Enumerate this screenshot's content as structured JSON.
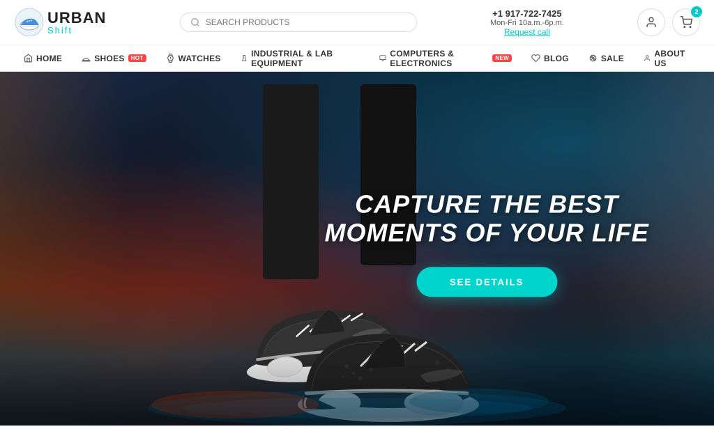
{
  "logo": {
    "urban": "URBAN",
    "shift": "Shift"
  },
  "search": {
    "placeholder": "SEARCH PRODUCTS"
  },
  "contact": {
    "phone": "+1 917-722-7425",
    "hours": "Mon-Fri 10a.m.-6p.m.",
    "request": "Request call"
  },
  "cart": {
    "badge": "2"
  },
  "nav": {
    "items": [
      {
        "label": "HOME",
        "icon": "home-icon",
        "badge": null
      },
      {
        "label": "SHOES",
        "icon": "shoe-icon",
        "badge": "HOT",
        "badge_type": "hot"
      },
      {
        "label": "WATCHES",
        "icon": "watch-icon",
        "badge": null
      },
      {
        "label": "INDUSTRIAL & LAB EQUIPMENT",
        "icon": "lab-icon",
        "badge": null
      },
      {
        "label": "COMPUTERS & ELECTRONICS",
        "icon": "computer-icon",
        "badge": "NEW",
        "badge_type": "new"
      },
      {
        "label": "BLOG",
        "icon": "blog-icon",
        "badge": null
      },
      {
        "label": "SALE",
        "icon": "sale-icon",
        "badge": null
      },
      {
        "label": "ABOUT US",
        "icon": "user-icon",
        "badge": null
      }
    ]
  },
  "hero": {
    "title_line1": "CAPTURE THE BEST",
    "title_line2": "MOMENTS OF YOUR LIFE",
    "cta_label": "SEE DETAILS"
  }
}
